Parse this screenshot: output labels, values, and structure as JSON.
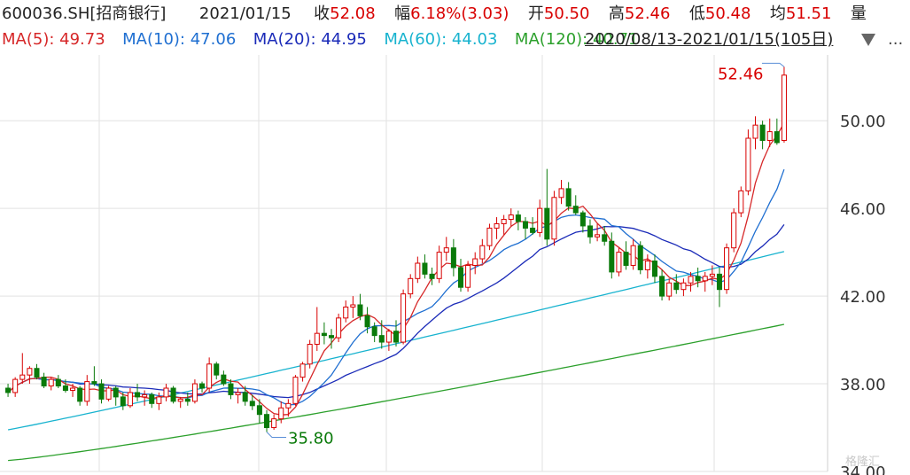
{
  "header": {
    "code": "600036.SH[招商银行]",
    "date": "2021/01/15",
    "close_label": "收",
    "close": "52.08",
    "change_label": "幅",
    "change": "6.18%(3.03)",
    "open_label": "开",
    "open": "50.50",
    "high_label": "高",
    "high": "52.46",
    "low_label": "低",
    "low": "50.48",
    "avg_label": "均",
    "avg": "51.51",
    "vol_label": "量"
  },
  "ma_legend": [
    {
      "label": "MA(5):",
      "value": "49.73",
      "color": "#d62728"
    },
    {
      "label": "MA(10):",
      "value": "47.06",
      "color": "#1f6fd1"
    },
    {
      "label": "MA(20):",
      "value": "44.95",
      "color": "#1b2bb8"
    },
    {
      "label": "MA(60):",
      "value": "44.03",
      "color": "#18b3cf"
    },
    {
      "label": "MA(120):",
      "value": "40.71",
      "color": "#2ca02c"
    }
  ],
  "range_text": "2020/08/13-2021/01/15(105日)",
  "more_icon": "...",
  "watermark": "格隆汇",
  "chart_data": {
    "type": "candlestick",
    "ylim": [
      34,
      53
    ],
    "yticks": [
      "34.00",
      "38.00",
      "42.00",
      "46.00",
      "50.00"
    ],
    "annotations": [
      {
        "text": "52.46",
        "kind": "high",
        "color": "#d80000"
      },
      {
        "text": "35.80",
        "kind": "low",
        "color": "#0a7a0a"
      }
    ],
    "up_color": "#d80000",
    "down_color": "#0a7a0a",
    "ohlc": [
      [
        37.8,
        38.0,
        37.4,
        37.6
      ],
      [
        37.6,
        38.3,
        37.4,
        38.2
      ],
      [
        38.2,
        39.4,
        38.0,
        38.4
      ],
      [
        38.4,
        38.8,
        38.0,
        38.7
      ],
      [
        38.7,
        38.9,
        38.2,
        38.3
      ],
      [
        38.3,
        38.5,
        37.8,
        37.9
      ],
      [
        37.9,
        38.3,
        37.7,
        38.2
      ],
      [
        38.2,
        38.4,
        37.8,
        37.9
      ],
      [
        37.9,
        38.2,
        37.6,
        37.7
      ],
      [
        37.7,
        38.0,
        37.4,
        37.8
      ],
      [
        37.8,
        37.9,
        37.0,
        37.2
      ],
      [
        37.2,
        38.4,
        37.0,
        38.1
      ],
      [
        38.1,
        38.8,
        37.9,
        38.0
      ],
      [
        38.0,
        38.2,
        37.1,
        37.3
      ],
      [
        37.3,
        37.9,
        37.2,
        37.8
      ],
      [
        37.8,
        37.9,
        37.0,
        37.4
      ],
      [
        37.4,
        37.6,
        36.8,
        37.0
      ],
      [
        37.0,
        37.8,
        36.9,
        37.6
      ],
      [
        37.6,
        38.0,
        37.2,
        37.4
      ],
      [
        37.4,
        37.7,
        37.0,
        37.5
      ],
      [
        37.5,
        37.6,
        36.9,
        37.1
      ],
      [
        37.1,
        37.6,
        36.8,
        37.4
      ],
      [
        37.4,
        38.0,
        37.2,
        37.8
      ],
      [
        37.8,
        37.9,
        37.1,
        37.2
      ],
      [
        37.2,
        37.4,
        36.9,
        37.3
      ],
      [
        37.3,
        37.6,
        37.0,
        37.2
      ],
      [
        37.2,
        38.2,
        37.1,
        38.0
      ],
      [
        38.0,
        38.1,
        37.6,
        37.8
      ],
      [
        37.8,
        39.2,
        37.6,
        38.9
      ],
      [
        38.9,
        39.0,
        38.2,
        38.4
      ],
      [
        38.4,
        38.6,
        37.9,
        38.0
      ],
      [
        38.0,
        38.2,
        37.3,
        37.5
      ],
      [
        37.5,
        37.8,
        37.1,
        37.6
      ],
      [
        37.6,
        37.9,
        37.0,
        37.2
      ],
      [
        37.2,
        37.5,
        36.8,
        37.0
      ],
      [
        37.0,
        37.3,
        36.2,
        36.6
      ],
      [
        36.6,
        36.8,
        35.8,
        36.0
      ],
      [
        36.0,
        36.6,
        35.9,
        36.4
      ],
      [
        36.4,
        37.2,
        36.2,
        36.9
      ],
      [
        36.9,
        37.3,
        36.5,
        37.1
      ],
      [
        37.1,
        38.4,
        37.0,
        38.3
      ],
      [
        38.3,
        39.0,
        38.1,
        38.9
      ],
      [
        38.9,
        40.0,
        38.7,
        39.8
      ],
      [
        39.8,
        41.5,
        39.5,
        40.3
      ],
      [
        40.3,
        40.8,
        39.8,
        40.2
      ],
      [
        40.2,
        40.5,
        39.6,
        40.1
      ],
      [
        40.1,
        41.2,
        39.9,
        41.0
      ],
      [
        41.0,
        41.8,
        40.8,
        41.5
      ],
      [
        41.5,
        42.0,
        41.0,
        41.6
      ],
      [
        41.6,
        42.1,
        40.9,
        41.1
      ],
      [
        41.1,
        41.5,
        40.3,
        40.6
      ],
      [
        40.6,
        40.8,
        39.9,
        40.2
      ],
      [
        40.2,
        40.9,
        39.6,
        39.9
      ],
      [
        39.9,
        40.5,
        39.5,
        40.4
      ],
      [
        40.4,
        40.9,
        39.7,
        39.9
      ],
      [
        39.9,
        42.3,
        39.8,
        42.1
      ],
      [
        42.1,
        43.0,
        41.9,
        42.8
      ],
      [
        42.8,
        43.8,
        42.6,
        43.5
      ],
      [
        43.5,
        43.9,
        42.8,
        43.0
      ],
      [
        43.0,
        43.3,
        42.5,
        42.8
      ],
      [
        42.8,
        44.3,
        42.6,
        44.0
      ],
      [
        44.0,
        44.7,
        43.6,
        44.2
      ],
      [
        44.2,
        44.6,
        42.9,
        43.3
      ],
      [
        43.3,
        43.7,
        42.2,
        42.4
      ],
      [
        42.4,
        43.6,
        42.2,
        43.4
      ],
      [
        43.4,
        44.0,
        43.0,
        43.7
      ],
      [
        43.7,
        44.6,
        43.5,
        44.3
      ],
      [
        44.3,
        45.3,
        44.1,
        45.1
      ],
      [
        45.1,
        45.6,
        44.6,
        45.3
      ],
      [
        45.3,
        45.7,
        44.8,
        45.5
      ],
      [
        45.5,
        46.0,
        45.2,
        45.7
      ],
      [
        45.7,
        45.9,
        45.0,
        45.4
      ],
      [
        45.4,
        45.6,
        44.6,
        45.1
      ],
      [
        45.1,
        45.6,
        44.8,
        44.9
      ],
      [
        44.9,
        46.4,
        44.7,
        46.0
      ],
      [
        46.0,
        47.8,
        44.3,
        44.6
      ],
      [
        44.6,
        46.8,
        44.3,
        46.5
      ],
      [
        46.5,
        47.3,
        46.2,
        46.9
      ],
      [
        46.9,
        47.2,
        45.9,
        46.1
      ],
      [
        46.1,
        46.6,
        45.7,
        45.8
      ],
      [
        45.8,
        45.9,
        44.9,
        45.2
      ],
      [
        45.2,
        45.5,
        44.4,
        44.7
      ],
      [
        44.7,
        45.3,
        44.5,
        44.8
      ],
      [
        44.8,
        45.2,
        44.3,
        44.5
      ],
      [
        44.5,
        44.9,
        42.8,
        43.1
      ],
      [
        43.1,
        44.2,
        42.9,
        44.0
      ],
      [
        44.0,
        44.5,
        43.2,
        43.4
      ],
      [
        43.4,
        44.6,
        43.2,
        44.3
      ],
      [
        44.3,
        44.5,
        43.0,
        43.2
      ],
      [
        43.2,
        43.9,
        42.8,
        43.6
      ],
      [
        43.6,
        43.9,
        42.6,
        42.9
      ],
      [
        42.9,
        43.2,
        41.8,
        42.0
      ],
      [
        42.0,
        42.8,
        41.8,
        42.6
      ],
      [
        42.6,
        43.0,
        42.1,
        42.3
      ],
      [
        42.3,
        42.8,
        42.0,
        42.6
      ],
      [
        42.6,
        43.1,
        42.2,
        42.9
      ],
      [
        42.9,
        43.3,
        42.4,
        42.7
      ],
      [
        42.7,
        43.1,
        42.2,
        42.9
      ],
      [
        42.9,
        43.4,
        42.5,
        43.0
      ],
      [
        43.0,
        43.3,
        41.5,
        42.3
      ],
      [
        42.3,
        44.4,
        42.1,
        44.2
      ],
      [
        44.2,
        46.0,
        44.0,
        45.8
      ],
      [
        45.8,
        47.0,
        45.6,
        46.8
      ],
      [
        46.8,
        49.6,
        46.6,
        49.2
      ],
      [
        49.2,
        50.2,
        48.7,
        49.8
      ],
      [
        49.8,
        50.0,
        48.7,
        49.1
      ],
      [
        49.1,
        50.1,
        48.8,
        49.5
      ],
      [
        49.5,
        50.1,
        48.9,
        49.0
      ],
      [
        49.1,
        52.46,
        49.0,
        52.08
      ]
    ]
  }
}
